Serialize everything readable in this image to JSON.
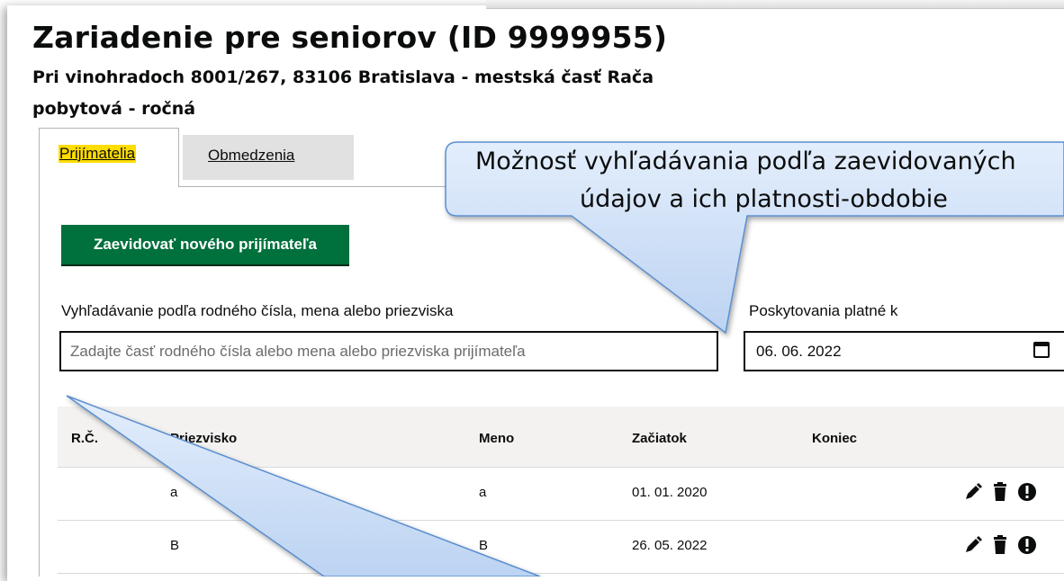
{
  "header": {
    "title": "Zariadenie pre seniorov (ID 9999955)",
    "address": "Pri vinohradoch 8001/267, 83106 Bratislava - mestská časť Rača",
    "service_type": "pobytová - ročná"
  },
  "tabs": [
    {
      "label": "Prijímatelia",
      "active": true
    },
    {
      "label": "Obmedzenia",
      "active": false
    }
  ],
  "actions": {
    "add_button": "Zaevidovať nového prijímateľa"
  },
  "search": {
    "label": "Vyhľadávanie podľa rodného čísla, mena alebo priezviska",
    "placeholder": "Zadajte časť rodného čísla alebo mena alebo priezviska prijímateľa",
    "value": ""
  },
  "date_filter": {
    "label": "Poskytovania platné k",
    "value": "06. 06. 2022"
  },
  "table": {
    "columns": [
      "R.Č.",
      "Priezvisko",
      "Meno",
      "Začiatok",
      "Koniec"
    ],
    "rows": [
      {
        "rc": "",
        "priezvisko": "a",
        "meno": "a",
        "zaciatok": "01. 01. 2020",
        "koniec": ""
      },
      {
        "rc": "",
        "priezvisko": "B",
        "meno": "B",
        "zaciatok": "26. 05. 2022",
        "koniec": ""
      }
    ],
    "row_action_icons": [
      "pencil-icon",
      "trash-icon",
      "exclamation-icon"
    ]
  },
  "callout": {
    "line1": "Možnosť vyhľadávania podľa zaevidovaných",
    "line2": "údajov a ich platnosti-obdobie"
  },
  "colors": {
    "primary_button": "#00703c",
    "active_tab_highlight": "#ffdd00",
    "callout_fill": "#cfe0f7",
    "callout_stroke": "#5b8fcf",
    "table_header_bg": "#f3f2f1"
  }
}
